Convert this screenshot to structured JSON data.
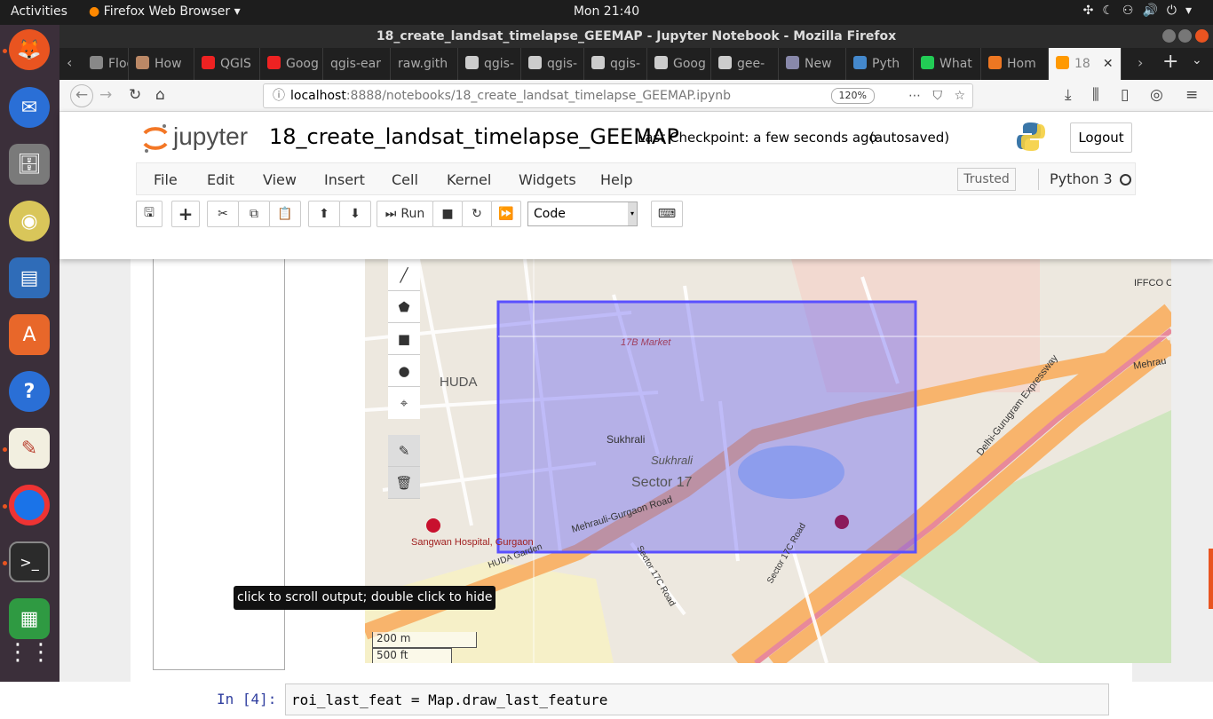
{
  "topbar": {
    "activities": "Activities",
    "app_name": "Firefox Web Browser",
    "clock": "Mon 21:40"
  },
  "window": {
    "title": "18_create_landsat_timelapse_GEEMAP - Jupyter Notebook - Mozilla Firefox"
  },
  "tabs": [
    {
      "label": "Flood",
      "fav": "#888"
    },
    {
      "label": "How",
      "fav": "#b86"
    },
    {
      "label": "QGIS",
      "fav": "#e22"
    },
    {
      "label": "Goog",
      "fav": "#e22"
    },
    {
      "label": "qgis-ear",
      "fav": ""
    },
    {
      "label": "raw.gith",
      "fav": ""
    },
    {
      "label": "qgis-",
      "fav": "#ccc"
    },
    {
      "label": "qgis-",
      "fav": "#ccc"
    },
    {
      "label": "qgis-",
      "fav": "#ccc"
    },
    {
      "label": "Goog",
      "fav": "#ccc"
    },
    {
      "label": "gee-",
      "fav": "#ccc"
    },
    {
      "label": "New",
      "fav": "#88a"
    },
    {
      "label": "Pyth",
      "fav": "#48c"
    },
    {
      "label": "What",
      "fav": "#2c5"
    },
    {
      "label": "Hom",
      "fav": "#e72"
    },
    {
      "label": "18",
      "fav": "#f90"
    }
  ],
  "navbar": {
    "url_host": "localhost",
    "url_rest": ":8888/notebooks/18_create_landsat_timelapse_GEEMAP.ipynb",
    "zoom": "120%"
  },
  "jupyter": {
    "logo_text": "jupyter",
    "notebook_name": "18_create_landsat_timelapse_GEEMAP",
    "checkpoint": "Last Checkpoint: a few seconds ago",
    "autosaved": "(autosaved)",
    "logout": "Logout",
    "menu": [
      "File",
      "Edit",
      "View",
      "Insert",
      "Cell",
      "Kernel",
      "Widgets",
      "Help"
    ],
    "trusted": "Trusted",
    "kernel_name": "Python 3",
    "run_label": "Run",
    "cell_type": "Code"
  },
  "map": {
    "labels": {
      "huda": "HUDA",
      "market": "17B Market",
      "sukhrali1": "Sukhrali",
      "sukhrali2": "Sukhrali",
      "sector": "Sector 17",
      "road1": "Mehrauli-Gurgaon Road",
      "road2": "HUDA Garden",
      "road3": "Sector 17C Road",
      "road4": "Sector 17C Road",
      "expressway": "Delhi-Gurugram Expressway",
      "iffco": "IFFCO Chowk",
      "mehrau": "Mehrau",
      "hospital": "Sangwan Hospital, Gurgaon"
    },
    "scale_m": "200 m",
    "scale_ft": "500 ft"
  },
  "tooltip": "click to scroll output; double click to hide",
  "next_cell": {
    "prompt": "In [4]:",
    "code": "roi_last_feat = Map.draw_last_feature"
  },
  "colors": {
    "selection_fill": "#6a62f2",
    "road_orange": "#f8b46c",
    "dock_bg": "#3b2f3a",
    "accent": "#e95420"
  }
}
